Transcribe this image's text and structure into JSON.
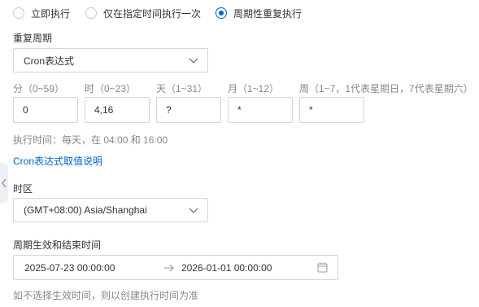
{
  "execution_mode": {
    "options": [
      {
        "label": "立即执行",
        "checked": false
      },
      {
        "label": "仅在指定时间执行一次",
        "checked": false
      },
      {
        "label": "周期性重复执行",
        "checked": true
      }
    ]
  },
  "repeat_cycle": {
    "label": "重复周期",
    "selected": "Cron表达式"
  },
  "cron": {
    "fields": [
      {
        "label": "分（0~59）",
        "value": "0"
      },
      {
        "label": "时（0~23）",
        "value": "4,16"
      },
      {
        "label": "天（1~31）",
        "value": "?"
      },
      {
        "label": "月（1~12）",
        "value": "*"
      },
      {
        "label": "周（1~7，1代表星期日，7代表星期六）",
        "value": "*"
      }
    ],
    "exec_time_text": "执行时间：每天，在 04:00 和 16:00",
    "help_link": "Cron表达式取值说明"
  },
  "timezone": {
    "label": "时区",
    "selected": "(GMT+08:00) Asia/Shanghai"
  },
  "effective_period": {
    "label": "周期生效和结束时间",
    "start": "2025-07-23 00:00:00",
    "end": "2026-01-01 00:00:00",
    "hint": "如不选择生效时间，则以创建执行时间为准"
  },
  "colors": {
    "accent": "#0064c8",
    "border": "#d1d5de",
    "muted_text": "#888888"
  },
  "icons": [
    "chevron-down-icon",
    "arrow-right-icon",
    "calendar-icon",
    "chevron-left-icon"
  ]
}
